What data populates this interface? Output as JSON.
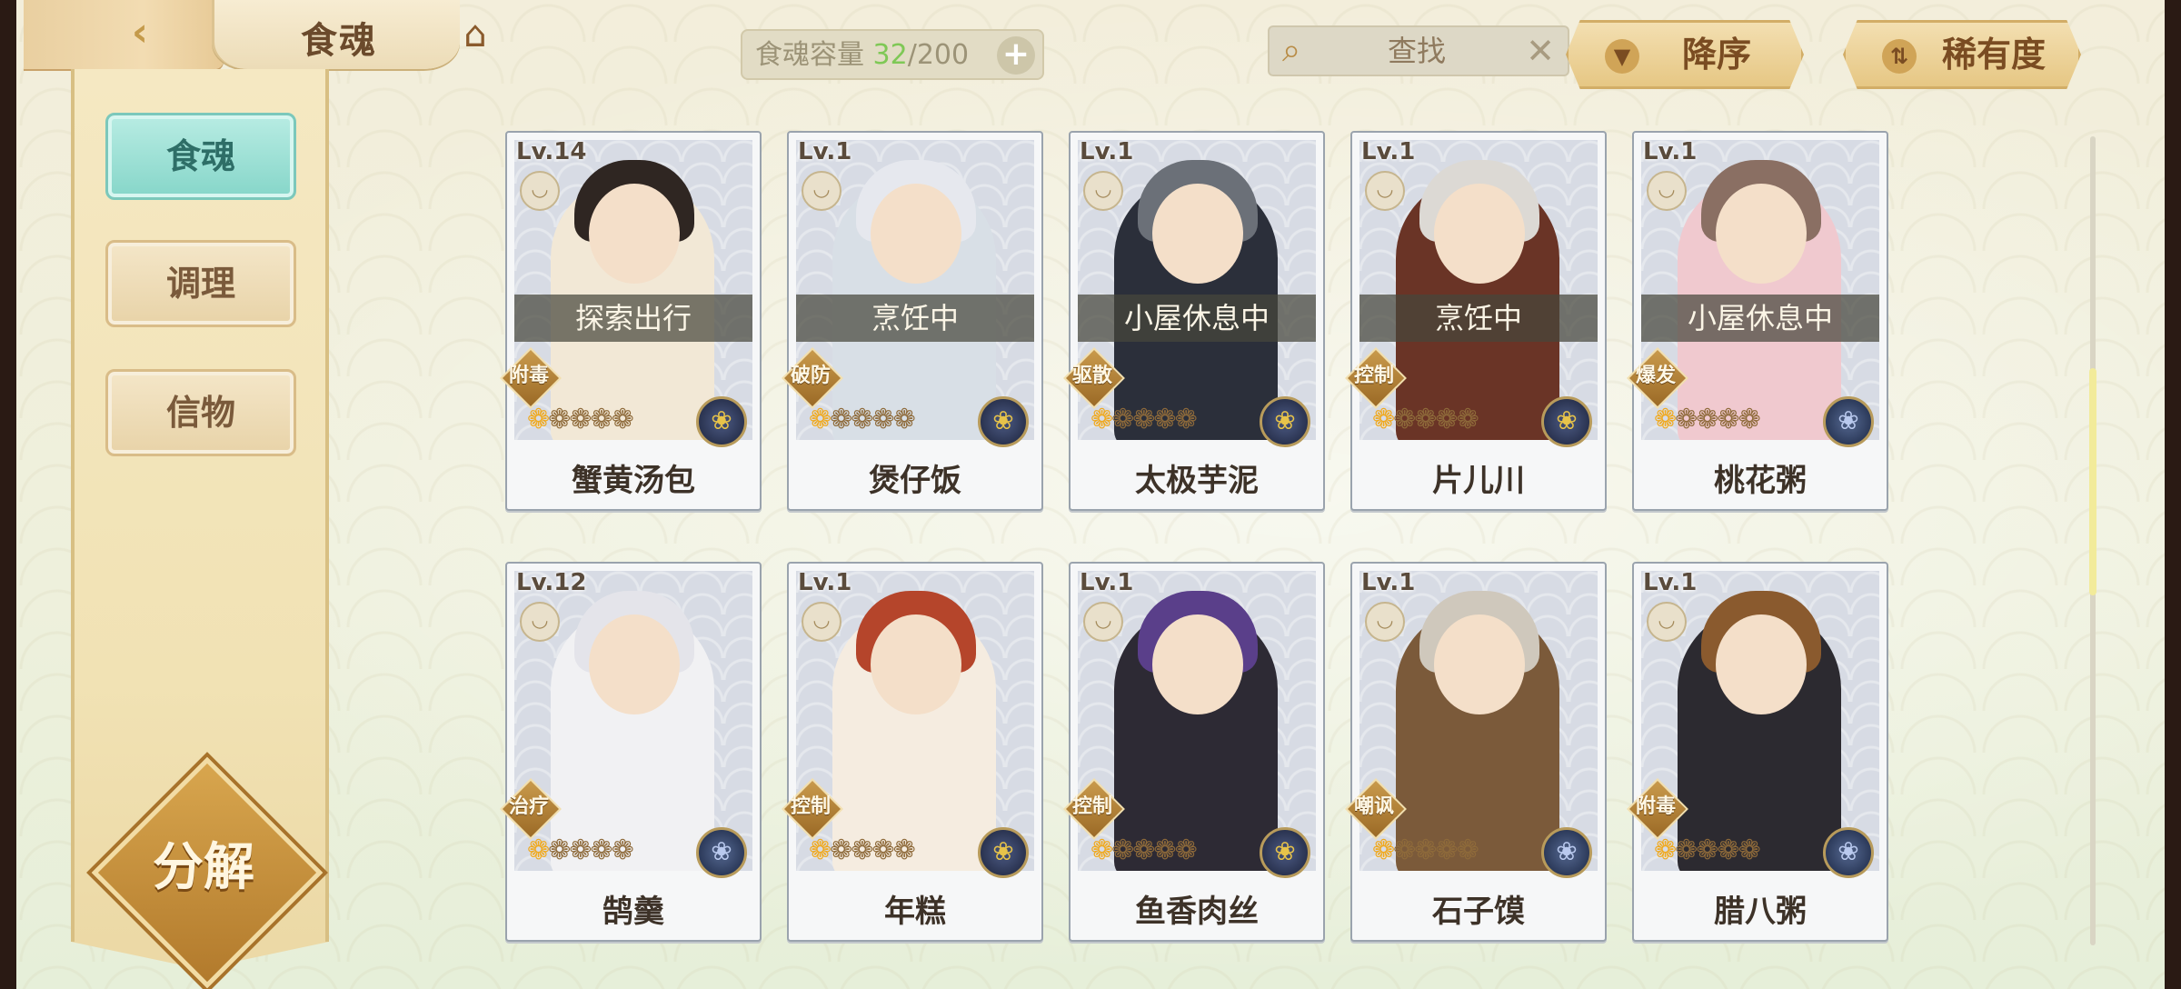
{
  "header": {
    "title": "食魂",
    "back_icon": "back-chevron-icon",
    "home_icon": "home-icon"
  },
  "capacity": {
    "label": "食魂容量",
    "current": "32",
    "max": "/200",
    "plus": "+"
  },
  "search": {
    "placeholder": "查找",
    "clear": "✕"
  },
  "sort": {
    "order_label": "降序",
    "rarity_label": "稀有度"
  },
  "sidebar": {
    "items": [
      {
        "label": "食魂",
        "active": true
      },
      {
        "label": "调理",
        "active": false
      },
      {
        "label": "信物",
        "active": false
      }
    ],
    "decompose_label": "分解"
  },
  "cards": [
    {
      "level": "Lv.14",
      "status": "探索出行",
      "role": "附毒",
      "name": "蟹黄汤包",
      "stars": 1,
      "element": "gold",
      "hair": "#2f2622",
      "coat": "#f2e8d6"
    },
    {
      "level": "Lv.1",
      "status": "烹饪中",
      "role": "破防",
      "name": "煲仔饭",
      "stars": 1,
      "element": "gold",
      "hair": "#e6e8ee",
      "coat": "#d8dfe6"
    },
    {
      "level": "Lv.1",
      "status": "小屋休息中",
      "role": "驱散",
      "name": "太极芋泥",
      "stars": 1,
      "element": "gold",
      "hair": "#6b7078",
      "coat": "#2b2f3a"
    },
    {
      "level": "Lv.1",
      "status": "烹饪中",
      "role": "控制",
      "name": "片儿川",
      "stars": 1,
      "element": "gold",
      "hair": "#dcd9d4",
      "coat": "#6a3426"
    },
    {
      "level": "Lv.1",
      "status": "小屋休息中",
      "role": "爆发",
      "name": "桃花粥",
      "stars": 1,
      "element": "blue",
      "hair": "#8a6f63",
      "coat": "#f0c9cf"
    },
    {
      "level": "Lv.12",
      "status": "",
      "role": "治疗",
      "name": "鹄羹",
      "stars": 1,
      "element": "blue",
      "hair": "#e4e4ea",
      "coat": "#f1f1f3"
    },
    {
      "level": "Lv.1",
      "status": "",
      "role": "控制",
      "name": "年糕",
      "stars": 1,
      "element": "gold",
      "hair": "#b5452b",
      "coat": "#f5ece0"
    },
    {
      "level": "Lv.1",
      "status": "",
      "role": "控制",
      "name": "鱼香肉丝",
      "stars": 1,
      "element": "gold",
      "hair": "#5a3f8a",
      "coat": "#2d2a34"
    },
    {
      "level": "Lv.1",
      "status": "",
      "role": "嘲讽",
      "name": "石子馍",
      "stars": 1,
      "element": "blue",
      "hair": "#cfc8bc",
      "coat": "#7b5a3a"
    },
    {
      "level": "Lv.1",
      "status": "",
      "role": "附毒",
      "name": "腊八粥",
      "stars": 1,
      "element": "blue",
      "hair": "#8a5a2e",
      "coat": "#2c2a30"
    }
  ]
}
